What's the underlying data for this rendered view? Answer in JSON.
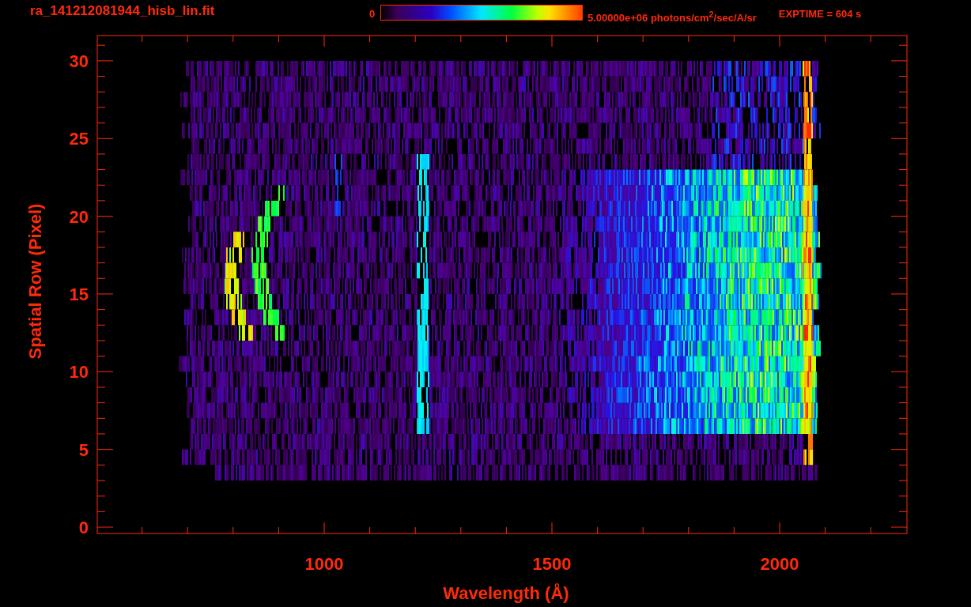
{
  "header": {
    "title": "ra_141212081944_hisb_lin.fit",
    "colorbar": {
      "min_label": "0",
      "max_label": "5.00000e+06 photons/cm$^{2}$/sec/A/sr"
    },
    "exposure": "EXPTIME = 604 s"
  },
  "plot": {
    "xlabel": "Wavelength (Å)",
    "ylabel": "Spatial Row (Pixel)",
    "xticks": [
      "1000",
      "1500",
      "2000"
    ],
    "yticks": [
      "30",
      "25",
      "20",
      "15",
      "10",
      "5",
      "0"
    ]
  }
}
